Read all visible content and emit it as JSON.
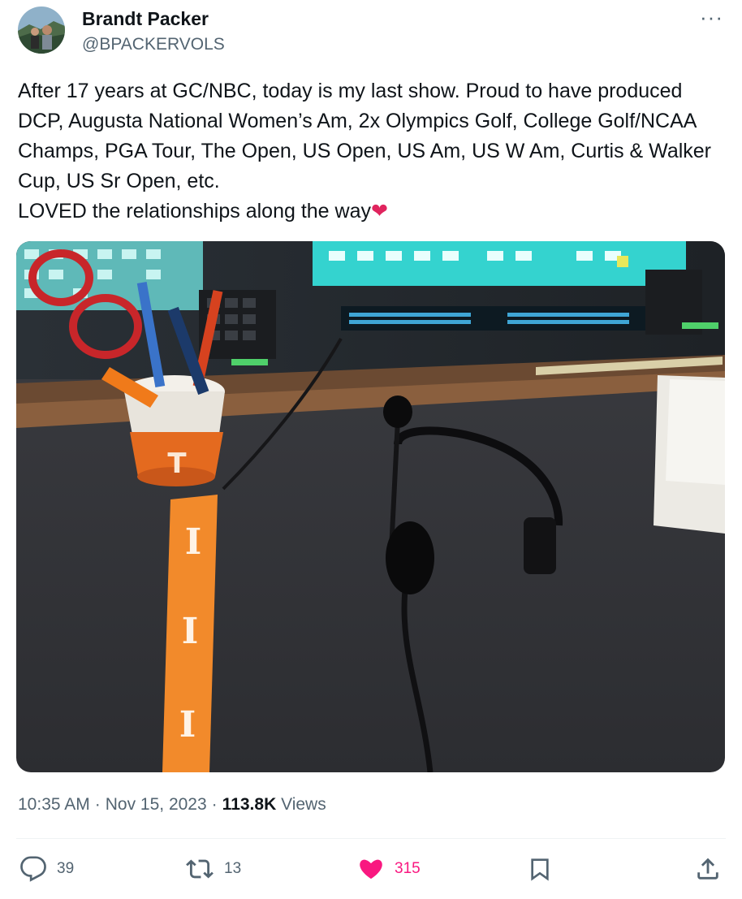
{
  "author": {
    "name": "Brandt Packer",
    "handle": "@BPACKERVOLS"
  },
  "more_icon": "ellipsis-icon",
  "tweet": {
    "text": "After 17 years at GC/NBC, today is my last show. Proud to have produced DCP, Augusta National Women’s Am, 2x Olympics Golf, College Golf/NCAA Champs, PGA Tour, The Open, US Open, US Am, US W Am, Curtis & Walker Cup, US Sr Open, etc.\nLOVED the relationships along the way",
    "emoji": "❤"
  },
  "meta": {
    "time": "10:35 AM",
    "sep1": "·",
    "date": "Nov 15, 2023",
    "sep2": "·",
    "views_count": "113.8K",
    "views_label": "Views"
  },
  "actions": {
    "replies": "39",
    "reposts": "13",
    "likes": "315"
  },
  "colors": {
    "like": "#f91880",
    "secondary_text": "#536471",
    "primary_text": "#0f1419"
  }
}
